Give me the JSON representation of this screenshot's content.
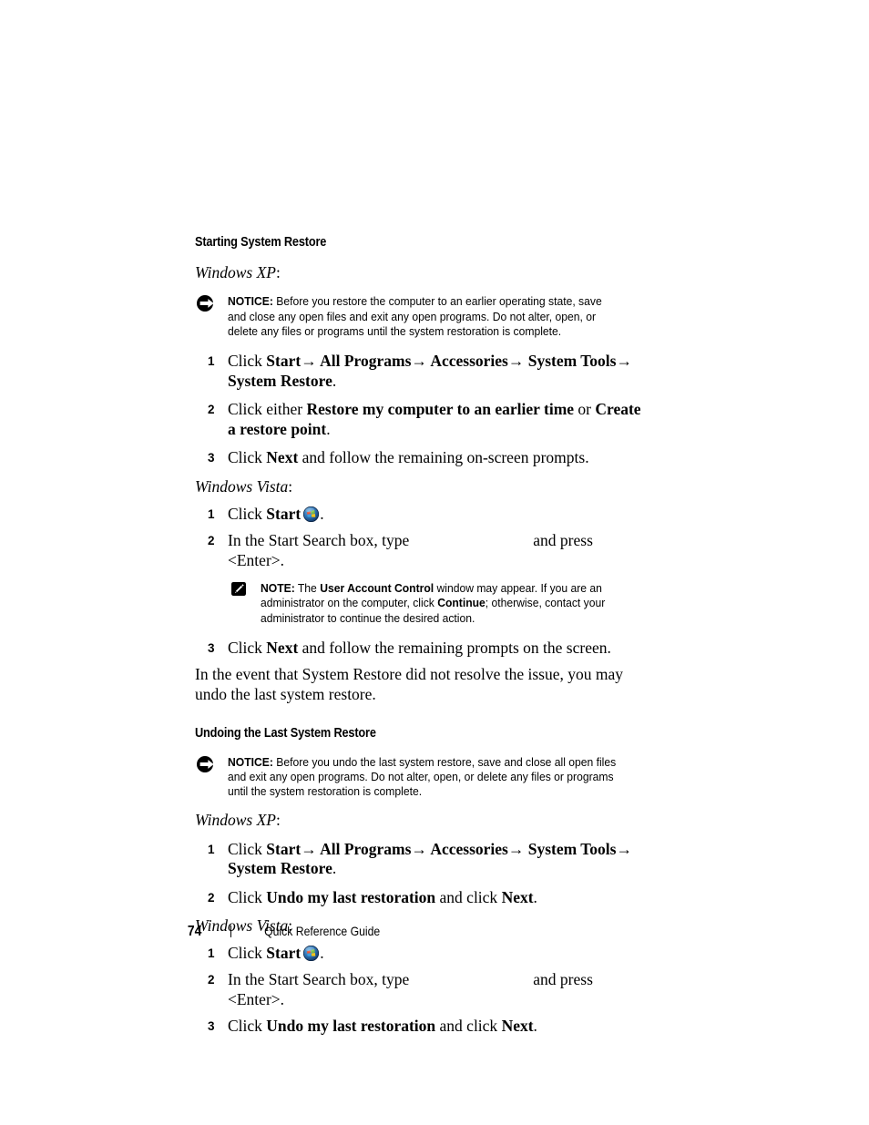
{
  "document": {
    "footer": {
      "page_number": "74",
      "title": "Quick Reference Guide"
    }
  },
  "sections": [
    {
      "heading": "Starting System Restore",
      "os_xp_label": "Windows XP",
      "os_vista_label": "Windows Vista"
    },
    {
      "heading": "Undoing the Last System Restore"
    }
  ],
  "headings": {
    "starting": "Starting System Restore",
    "undoing": "Undoing the Last System Restore"
  },
  "os_labels": {
    "xp": "Windows XP",
    "vista": "Windows Vista",
    "colon": ":"
  },
  "notice1": {
    "icon": "notice-arrow-icon",
    "label": "NOTICE:",
    "text": " Before you restore the computer to an earlier operating state, save and close any open files and exit any open programs. Do not alter, open, or delete any files or programs until the system restoration is complete."
  },
  "notice2": {
    "icon": "notice-arrow-icon",
    "label": "NOTICE:",
    "text": " Before you undo the last system restore, save and close all open files and exit any open programs. Do not alter, open, or delete any files or programs until the system restoration is complete."
  },
  "note1": {
    "icon": "note-pencil-icon",
    "label": "NOTE:",
    "text_part1": " The ",
    "bold1": "User Account Control",
    "text_part2": " window may appear. If you are an administrator on the computer, click ",
    "bold2": "Continue",
    "text_part3": "; otherwise, contact your administrator to continue the desired action."
  },
  "xp_start_steps": {
    "step1": {
      "num": "1",
      "click": "Click ",
      "start": "Start",
      "arrow1": "→",
      "all_programs": " All Programs",
      "arrow2": "→",
      "accessories": " Accessories",
      "arrow3": "→",
      "system_tools": " System Tools",
      "arrow4": "→",
      "system_restore": " System Restore",
      "period": "."
    },
    "step2": {
      "num": "2",
      "lead": "Click either ",
      "bold1": "Restore my computer to an earlier time",
      "mid": " or ",
      "bold2": "Create a restore point",
      "period": "."
    },
    "step3": {
      "num": "3",
      "lead": "Click ",
      "bold1": "Next",
      "tail": " and follow the remaining on-screen prompts."
    }
  },
  "vista_start_steps": {
    "step1": {
      "num": "1",
      "lead": "Click ",
      "bold1": "Start",
      "icon": "windows-start-orb-icon",
      "period": "."
    },
    "step2": {
      "num": "2",
      "lead": "In the Start Search box, type",
      "typed_value": "",
      "tail": "and press <Enter>."
    },
    "step3": {
      "num": "3",
      "lead": "Click ",
      "bold1": "Next",
      "tail": " and follow the remaining prompts on the screen."
    }
  },
  "transition_paragraph": "In the event that System Restore did not resolve the issue, you may undo the last system restore.",
  "xp_undo_steps": {
    "step1": {
      "num": "1",
      "click": "Click ",
      "start": "Start",
      "arrow1": "→",
      "all_programs": " All Programs",
      "arrow2": "→",
      "accessories": " Accessories",
      "arrow3": "→",
      "system_tools": " System Tools",
      "arrow4": "→",
      "system_restore": " System Restore",
      "period": "."
    },
    "step2": {
      "num": "2",
      "lead": "Click ",
      "bold1": "Undo my last restoration",
      "mid": " and click ",
      "bold2": "Next",
      "period": "."
    }
  },
  "vista_undo_steps": {
    "step1": {
      "num": "1",
      "lead": "Click ",
      "bold1": "Start",
      "icon": "windows-start-orb-icon",
      "period": "."
    },
    "step2": {
      "num": "2",
      "lead": "In the Start Search box, type",
      "typed_value": "",
      "tail": "and press <Enter>."
    },
    "step3": {
      "num": "3",
      "lead": "Click ",
      "bold1": "Undo my last restoration",
      "mid": " and click ",
      "bold2": "Next",
      "period": "."
    }
  },
  "colors": {
    "text": "#000000",
    "page_background": "#ffffff",
    "orb_blue": "#1f4e8c",
    "orb_pane_red": "#e8583a",
    "orb_pane_green": "#7cc142",
    "orb_pane_blue": "#3aa0e0",
    "orb_pane_yellow": "#f5c518"
  }
}
